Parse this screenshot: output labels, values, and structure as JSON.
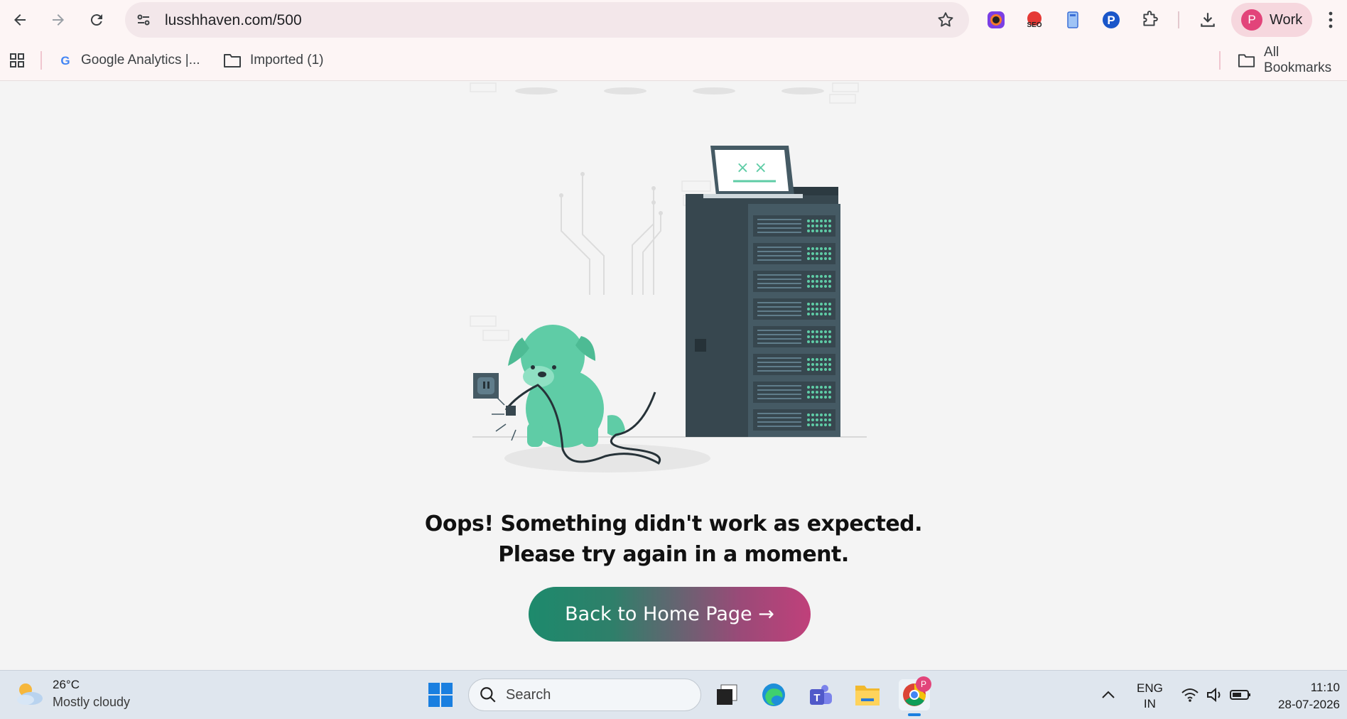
{
  "browser": {
    "url": "lusshhaven.com/500",
    "profile_initial": "P",
    "profile_label": "Work"
  },
  "bookmarks": {
    "items": [
      {
        "label": "Google Analytics  |..."
      },
      {
        "label": "Imported (1)"
      }
    ],
    "all_bookmarks": "All Bookmarks"
  },
  "illustration": {
    "laptop_face": "× ×"
  },
  "content": {
    "message_line1": "Oops! Something didn't work as expected.",
    "message_line2": "Please try again in a moment.",
    "home_button": "Back to Home Page →"
  },
  "taskbar": {
    "weather_temp": "26°C",
    "weather_condition": "Mostly cloudy",
    "search_placeholder": "Search",
    "language_top": "ENG",
    "language_bottom": "IN",
    "time": "11:10",
    "date": "28-07-2026",
    "chrome_badge": "P"
  },
  "colors": {
    "accent_green": "#1d8a6c",
    "accent_pink": "#c0407a",
    "dog_green": "#5fcca6",
    "server_dark": "#37474f"
  }
}
